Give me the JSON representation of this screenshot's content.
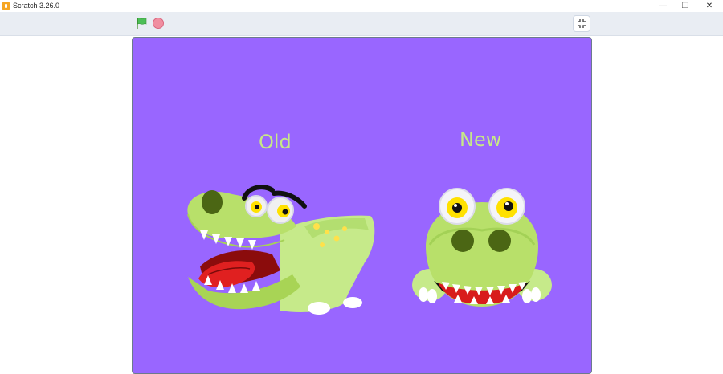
{
  "window": {
    "title": "Scratch 3.26.0",
    "minimize_glyph": "—",
    "maximize_glyph": "❐",
    "close_glyph": "✕"
  },
  "toolbar": {
    "green_flag_icon": "flag-icon",
    "stop_icon": "stop-icon",
    "fullscreen_icon": "exit-fullscreen-icon"
  },
  "stage": {
    "background": "#9966ff",
    "label_color": "#c7e886",
    "sprites": [
      {
        "label": "Old",
        "icon": "old-crocodile-sprite"
      },
      {
        "label": "New",
        "icon": "new-crocodile-sprite"
      }
    ]
  }
}
